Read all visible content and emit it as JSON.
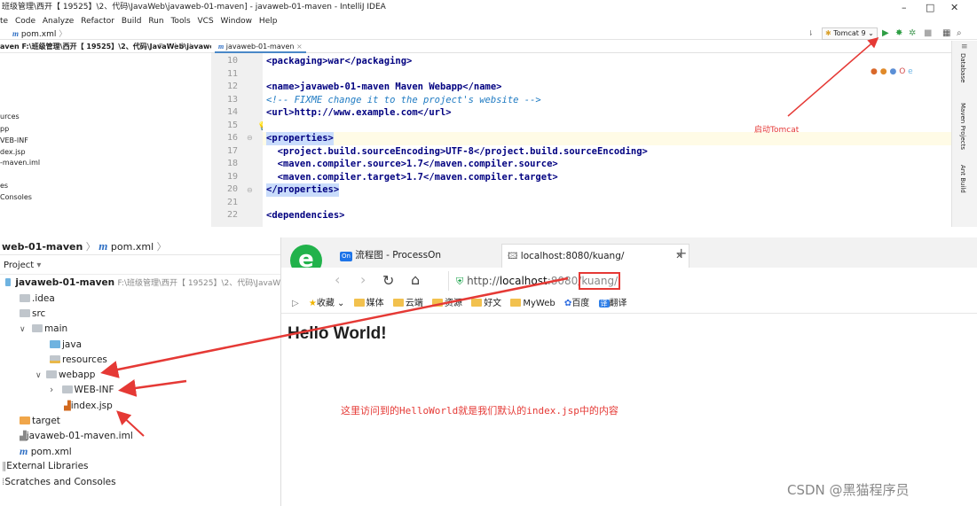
{
  "window": {
    "title": "班级管理\\西开【 19525】\\2、代码\\JavaWeb\\javaweb-01-maven] - javaweb-01-maven - IntelliJ IDEA",
    "minimize": "–",
    "maximize": "□",
    "close": "✕"
  },
  "menu": [
    "te",
    "Code",
    "Analyze",
    "Refactor",
    "Build",
    "Run",
    "Tools",
    "VCS",
    "Window",
    "Help"
  ],
  "top_nav": {
    "crumb": "pom.xml",
    "crumb_sep": "〉"
  },
  "toolbar": {
    "run_config": "Tomcat 9",
    "run_config_arrow": "⌄"
  },
  "top_project_panel": {
    "header": "aven  F:\\班级管理\\西开【 19525】\\2、代码\\JavaWeb\\javaweb-01-m",
    "items": [
      "urces",
      "pp",
      "VEB-INF",
      "dex.jsp",
      "-maven.iml",
      "",
      "es",
      "Consoles"
    ]
  },
  "editor": {
    "tab": "javaweb-01-maven",
    "tab_close": "×",
    "line_numbers": [
      "10",
      "11",
      "12",
      "13",
      "14",
      "15",
      "16",
      "17",
      "18",
      "19",
      "20",
      "21",
      "22"
    ],
    "lines": [
      {
        "t": "<packaging>war</packaging>",
        "k": "tag"
      },
      {
        "t": "",
        "k": ""
      },
      {
        "t": "<name>javaweb-01-maven Maven Webapp</name>",
        "k": "tag"
      },
      {
        "t": "<!-- FIXME change it to the project's website -->",
        "k": "cmt"
      },
      {
        "t": "<url>http://www.example.com</url>",
        "k": "tag"
      },
      {
        "t": "",
        "k": ""
      },
      {
        "t": "<properties>",
        "k": "tag"
      },
      {
        "t": "  <project.build.sourceEncoding>UTF-8</project.build.sourceEncoding>",
        "k": "tag"
      },
      {
        "t": "  <maven.compiler.source>1.7</maven.compiler.source>",
        "k": "tag"
      },
      {
        "t": "  <maven.compiler.target>1.7</maven.compiler.target>",
        "k": "tag"
      },
      {
        "t": "</properties>",
        "k": "tag"
      },
      {
        "t": "",
        "k": ""
      },
      {
        "t": "<dependencies>",
        "k": "tag"
      }
    ]
  },
  "right_sidebar": [
    "Database",
    "Maven Projects",
    "Ant Build"
  ],
  "annotation_tomcat": "启动Tomcat",
  "lower_ide": {
    "breadcrumb_project": "web-01-maven",
    "breadcrumb_sep": "〉",
    "breadcrumb_file": "pom.xml",
    "project_label": "Project",
    "project_arrow": "▾",
    "root_name": "javaweb-01-maven",
    "root_path": "F:\\班级管理\\西开【 19525】\\2、代码\\JavaWeb",
    "tree": {
      "idea": ".idea",
      "src": "src",
      "main": "main",
      "java": "java",
      "resources": "resources",
      "webapp": "webapp",
      "webinf": "WEB-INF",
      "index": "index.jsp",
      "target": "target",
      "iml": "javaweb-01-maven.iml",
      "pom": "pom.xml",
      "extlib": "External Libraries",
      "scratches": "Scratches and Consoles"
    },
    "expand_down": "∨",
    "expand_right": "›"
  },
  "browser": {
    "tab1": "流程图 - ProcessOn",
    "tab1_icon": "On",
    "tab2": "localhost:8080/kuang/",
    "tab2_close": "✕",
    "new_tab": "+",
    "url_prefix": "http://",
    "url_host": "localhost",
    "url_port": ":8080/",
    "url_path": "kuang/",
    "bookmarks": [
      "收藏",
      "媒体",
      "云端",
      "资源",
      "好文",
      "MyWeb",
      "百度",
      "翻译"
    ],
    "bookmark_arrow": "⌄",
    "sidebar_toggle": "▷",
    "page_heading": "Hello World!",
    "note": "这里访问到的HelloWorld就是我们默认的index.jsp中的内容"
  },
  "watermark": "CSDN @黑猫程序员",
  "colors": {
    "accent_arrow": "#e53935",
    "run_green": "#2e9e44",
    "tag_blue": "#000080",
    "comment_blue": "#1e7ac2",
    "folder_yellow": "#f2c14e",
    "folder_gray": "#c0c6cc",
    "folder_blue": "#6fb3e0"
  }
}
